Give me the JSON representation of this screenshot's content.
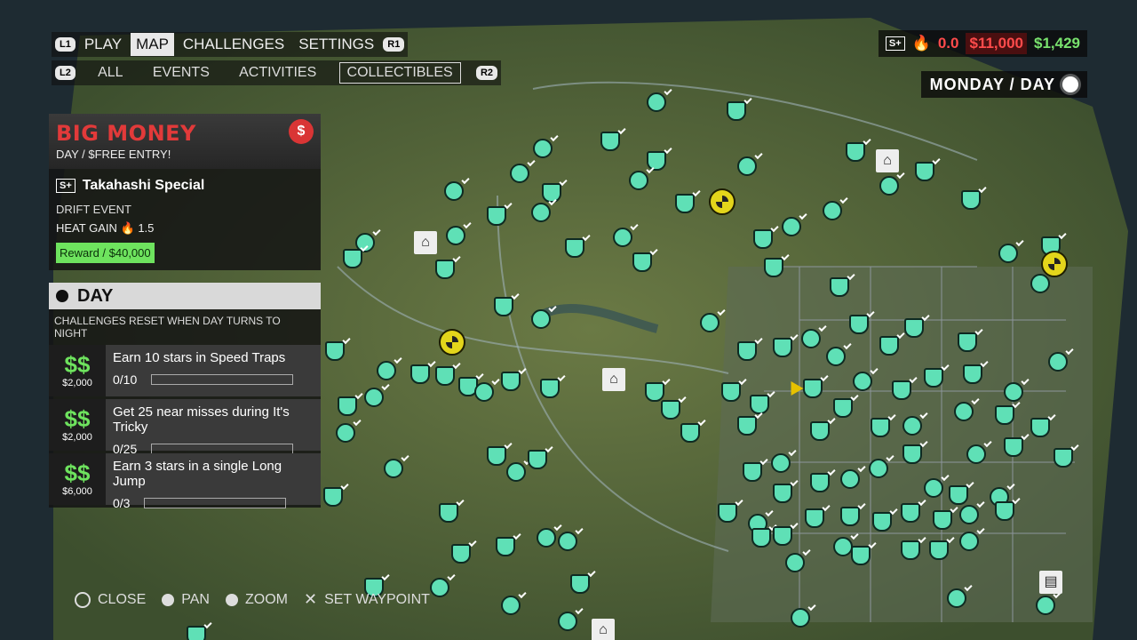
{
  "nav": {
    "l1": "L1",
    "r1": "R1",
    "l2": "L2",
    "r2": "R2",
    "tabs": [
      "PLAY",
      "MAP",
      "CHALLENGES",
      "SETTINGS"
    ],
    "active_tab": "MAP",
    "subtabs": [
      "ALL",
      "EVENTS",
      "ACTIVITIES",
      "COLLECTIBLES"
    ],
    "active_subtab": "COLLECTIBLES"
  },
  "hud": {
    "heat": "0.0",
    "bounty": "$11,000",
    "cash": "$1,429",
    "day_label": "MONDAY / DAY"
  },
  "event": {
    "title": "BIG MONEY",
    "subtitle": "DAY / $FREE ENTRY!",
    "badge": "S+",
    "name": "Takahashi Special",
    "type": "DRIFT EVENT",
    "heat_gain_label": "HEAT GAIN",
    "heat_gain": "1.5",
    "reward": "Reward / $40,000"
  },
  "challenges": {
    "header": "DAY",
    "note": "CHALLENGES RESET WHEN DAY TURNS TO NIGHT",
    "items": [
      {
        "reward": "$2,000",
        "text": "Earn 10 stars in Speed Traps",
        "progress": "0/10",
        "fraction": 0
      },
      {
        "reward": "$2,000",
        "text": "Get 25 near misses during It's Tricky",
        "progress": "0/25",
        "fraction": 0
      },
      {
        "reward": "$6,000",
        "text": "Earn 3 stars in a single Long Jump",
        "progress": "0/3",
        "fraction": 0
      }
    ]
  },
  "bottom": {
    "close": "CLOSE",
    "pan": "PAN",
    "zoom": "ZOOM",
    "waypoint": "SET WAYPOINT"
  },
  "colors": {
    "marker": "#5fe0b6",
    "event_red": "#e23a3a",
    "cash_green": "#79e26e"
  }
}
